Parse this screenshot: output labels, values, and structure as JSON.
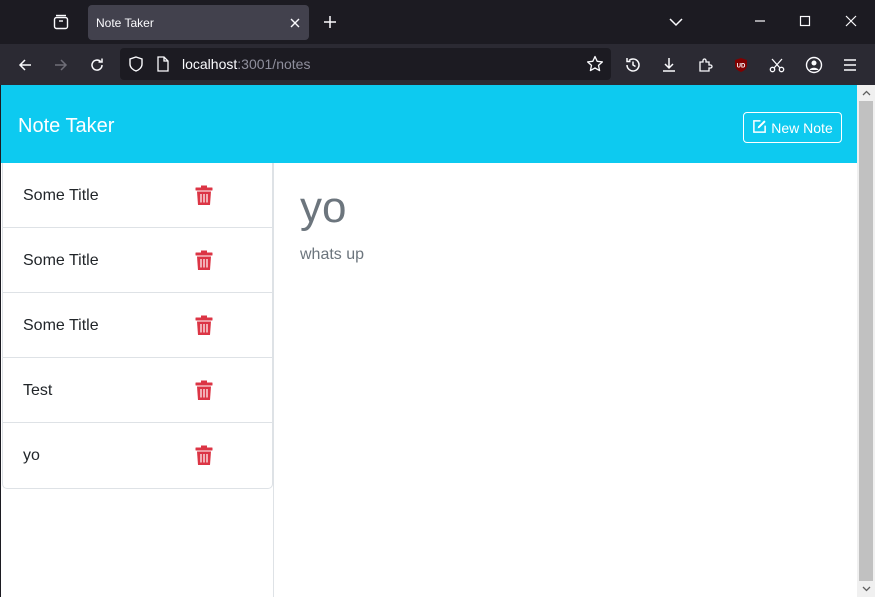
{
  "browser": {
    "tab_title": "Note Taker",
    "url_host": "localhost",
    "url_path": ":3001/notes"
  },
  "app": {
    "brand": "Note Taker",
    "new_note_label": "New Note"
  },
  "notes": [
    {
      "title": "Some Title"
    },
    {
      "title": "Some Title"
    },
    {
      "title": "Some Title"
    },
    {
      "title": "Test"
    },
    {
      "title": "yo"
    }
  ],
  "active_note": {
    "title": "yo",
    "text": "whats up"
  },
  "colors": {
    "accent": "#0dcaf0",
    "danger": "#dc3545"
  }
}
